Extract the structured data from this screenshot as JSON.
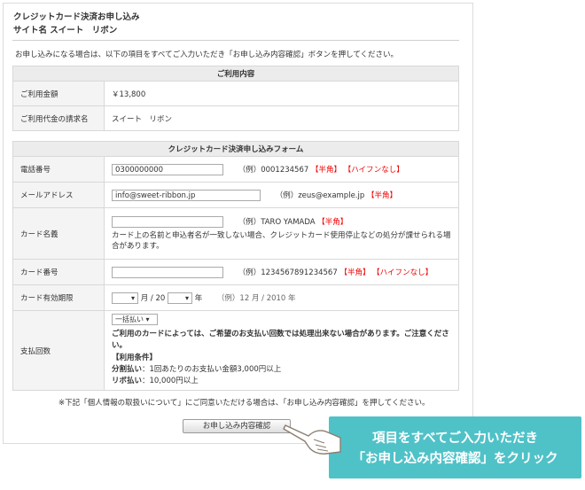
{
  "header": {
    "title_line1": "クレジットカード決済お申し込み",
    "title_line2": "サイト名 スイート　リボン"
  },
  "intro": "お申し込みになる場合は、以下の項目をすべてご入力いただき「お申し込み内容確認」ボタンを押してください。",
  "usage": {
    "heading": "ご利用内容",
    "rows": [
      {
        "label": "ご利用金額",
        "value": "￥13,800"
      },
      {
        "label": "ご利用代金の請求名",
        "value": "スイート　リボン"
      }
    ]
  },
  "form": {
    "heading": "クレジットカード決済申し込みフォーム",
    "phone": {
      "label": "電話番号",
      "value": "0300000000",
      "example": "（例）0001234567",
      "tag1": "【半角】",
      "tag2": "【ハイフンなし】"
    },
    "email": {
      "label": "メールアドレス",
      "value": "info@sweet-ribbon.jp",
      "example": "（例）zeus@example.jp",
      "tag1": "【半角】"
    },
    "card_name": {
      "label": "カード名義",
      "value": "",
      "example": "（例）TARO YAMADA",
      "tag1": "【半角】",
      "note": "カード上の名前と申込者名が一致しない場合、クレジットカード使用停止などの処分が課せられる場合があります。"
    },
    "card_number": {
      "label": "カード番号",
      "value": "",
      "example": "（例）1234567891234567",
      "tag1": "【半角】",
      "tag2": "【ハイフンなし】"
    },
    "expiry": {
      "label": "カード有効期限",
      "month_sep": "月 / 20",
      "year_suffix": "年",
      "example": "（例）12 月 / 2010 年"
    },
    "payment": {
      "label": "支払回数",
      "select_value": "一括払い",
      "warning": "ご利用のカードによっては、ご希望のお支払い回数では処理出来ない場合があります。ご注意ください。",
      "cond_title": "【利用条件】",
      "cond1_bold": "分割払い",
      "cond1_text": "：1回あたりのお支払い金額3,000円以上",
      "cond2_bold": "リボ払い",
      "cond2_text": "：10,000円以上"
    }
  },
  "footer_note": "※下記「個人情報の取扱いについて」にご同意いただける場合は、「お申し込み内容確認」を押してください。",
  "confirm_button": "お申し込み内容確認",
  "callout": {
    "line1": "項目をすべてご入力いただき",
    "line2": "「お申し込み内容確認」をクリック"
  },
  "colors": {
    "callout_bg": "#4fc2c8",
    "required_red": "#ee0000"
  },
  "icons": {
    "pointer": "pointing-hand-icon"
  }
}
